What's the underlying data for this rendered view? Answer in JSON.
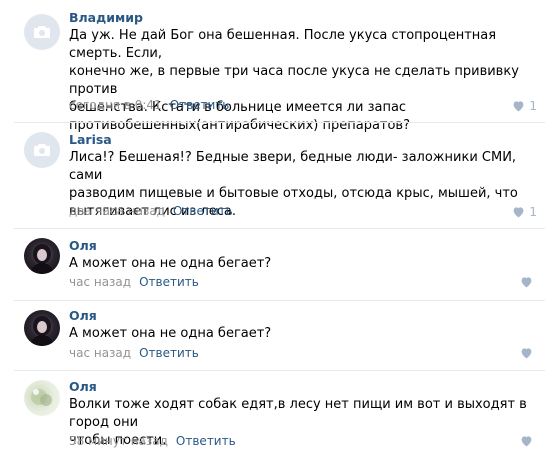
{
  "comments": [
    {
      "author": "Владимир",
      "avatar_type": "camera-placeholder",
      "text": "Да уж. Не дай Бог она бешенная. После укуса стопроцентная смерть. Если,\nконечно же, в первые три часа после укуса не сделать прививку против\nбешенства. Кстати в больнице имеется ли запас\nпротивобешенных(антирабических) препаратов?",
      "time": "сегодня в 0:41",
      "reply_label": "Ответить",
      "likes": "1"
    },
    {
      "author": "Larisa",
      "avatar_type": "camera-placeholder",
      "text": "Лиса!? Бешеная!? Бедные звери, бедные люди- заложники СМИ, сами\nразводим пищевые и бытовые отходы, отсюда крыс, мышей, что\nвытягивает лис из леса.",
      "time": "два часа назад",
      "reply_label": "Ответить",
      "likes": "1"
    },
    {
      "author": "Оля",
      "avatar_type": "dark-photo",
      "text": "А может она не одна бегает?",
      "time": "час назад",
      "reply_label": "Ответить",
      "likes": ""
    },
    {
      "author": "Оля",
      "avatar_type": "dark-photo",
      "text": "А может она не одна бегает?",
      "time": "час назад",
      "reply_label": "Ответить",
      "likes": ""
    },
    {
      "author": "Оля",
      "avatar_type": "light-photo",
      "text": "Волки тоже ходят собак едят,в лесу нет пищи им вот и выходят в город они\nчтобы поести.",
      "time": "58 минут назад",
      "reply_label": "Ответить",
      "likes": ""
    }
  ],
  "colors": {
    "link": "#2a5885",
    "meta": "#939393",
    "like": "#a5b6c8",
    "divider": "#e7e8ec"
  }
}
